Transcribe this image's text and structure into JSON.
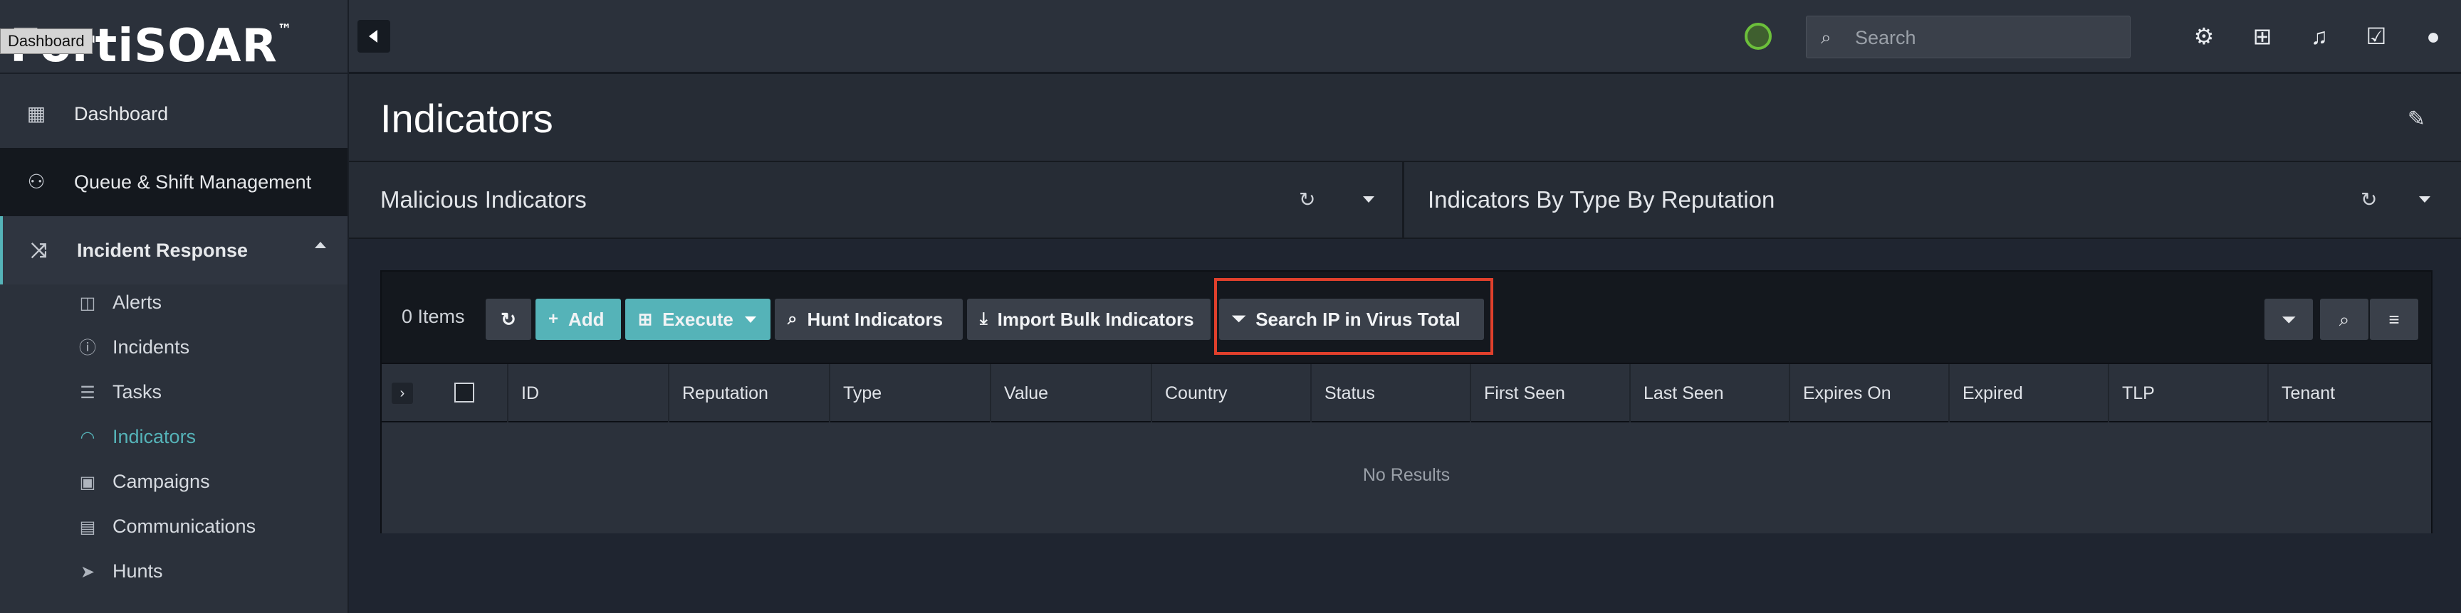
{
  "app": {
    "logo_text": "FortiSOAR",
    "logo_tm": "™",
    "tooltip": "Dashboard"
  },
  "sidebar": {
    "items": [
      {
        "label": "Dashboard",
        "icon": "grid-icon"
      },
      {
        "label": "Queue & Shift Management",
        "icon": "people-icon"
      },
      {
        "label": "Incident Response",
        "icon": "shuffle-icon"
      }
    ],
    "sub_items": [
      {
        "label": "Alerts",
        "icon": "alert-icon"
      },
      {
        "label": "Incidents",
        "icon": "incident-icon"
      },
      {
        "label": "Tasks",
        "icon": "tasks-icon"
      },
      {
        "label": "Indicators",
        "icon": "indicator-icon",
        "active": true
      },
      {
        "label": "Campaigns",
        "icon": "campaign-icon"
      },
      {
        "label": "Communications",
        "icon": "communications-icon"
      },
      {
        "label": "Hunts",
        "icon": "hunts-icon"
      }
    ]
  },
  "topbar": {
    "search_placeholder": "Search"
  },
  "page": {
    "title": "Indicators"
  },
  "widgets": [
    {
      "title": "Malicious Indicators"
    },
    {
      "title": "Indicators By Type By Reputation"
    }
  ],
  "grid": {
    "items_count": "0 Items",
    "buttons": {
      "add": "Add",
      "execute": "Execute",
      "hunt": "Hunt Indicators",
      "import": "Import Bulk Indicators",
      "search_vt": "Search IP in Virus Total"
    },
    "columns": [
      "ID",
      "Reputation",
      "Type",
      "Value",
      "Country",
      "Status",
      "First Seen",
      "Last Seen",
      "Expires On",
      "Expired",
      "TLP",
      "Tenant"
    ],
    "empty_text": "No Results"
  },
  "colors": {
    "accent": "#55b3b8",
    "highlight": "#e0402c",
    "status_green": "#6cbf3b"
  }
}
